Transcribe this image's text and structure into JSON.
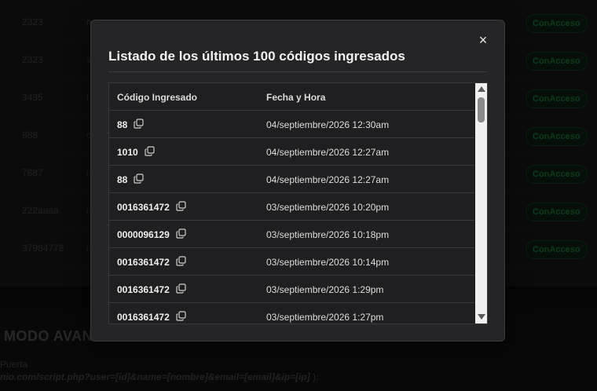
{
  "background": {
    "rows": [
      {
        "id": "2323",
        "name": "n",
        "status": "ConAcceso"
      },
      {
        "id": "2323",
        "name": "s",
        "status": "ConAcceso"
      },
      {
        "id": "3435",
        "name": "l",
        "status": "ConAcceso"
      },
      {
        "id": "888",
        "name": "c",
        "status": "ConAcceso"
      },
      {
        "id": "7687",
        "name": "n",
        "status": "ConAcceso"
      },
      {
        "id": "222aaaa",
        "name": "n",
        "status": "ConAcceso"
      },
      {
        "id": "37984778",
        "name": "n",
        "status": "ConAcceso"
      }
    ],
    "section_title": "MODO AVAN",
    "field_label": "Puerta",
    "url_text": "nio.com/script.php?user=[id]&name=[nombre]&email=[email]&ip=[ip]",
    "url_tail": " ):"
  },
  "modal": {
    "close_label": "×",
    "title": "Listado de los últimos 100 códigos ingresados",
    "columns": {
      "code": "Código Ingresado",
      "datetime": "Fecha y Hora"
    },
    "rows": [
      {
        "code": "88",
        "datetime": "04/septiembre/2026 12:30am"
      },
      {
        "code": "1010",
        "datetime": "04/septiembre/2026 12:27am"
      },
      {
        "code": "88",
        "datetime": "04/septiembre/2026 12:27am"
      },
      {
        "code": "0016361472",
        "datetime": "03/septiembre/2026 10:20pm"
      },
      {
        "code": "0000096129",
        "datetime": "03/septiembre/2026 10:18pm"
      },
      {
        "code": "0016361472",
        "datetime": "03/septiembre/2026 10:14pm"
      },
      {
        "code": "0016361472",
        "datetime": "03/septiembre/2026 1:29pm"
      },
      {
        "code": "0016361472",
        "datetime": "03/septiembre/2026 1:27pm"
      }
    ],
    "copy_icon": "copy-icon"
  },
  "colors": {
    "badge_text": "#1a6a34",
    "modal_bg": "#252527",
    "table_bg": "#1f1f21"
  }
}
